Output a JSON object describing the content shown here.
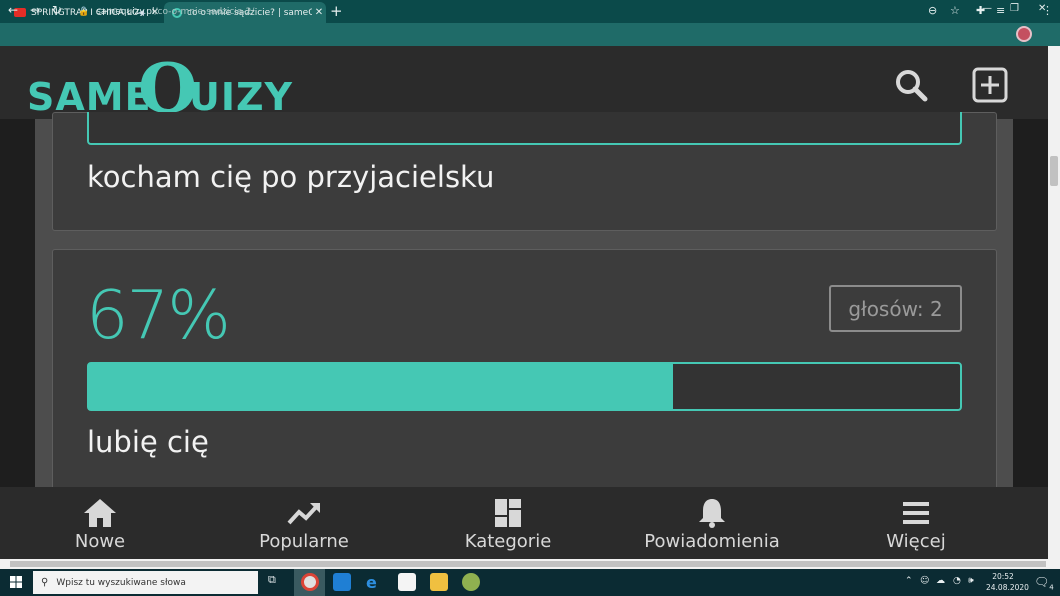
{
  "browser": {
    "tabs": [
      {
        "title": "SPRINGTRAP I CHICA ŁOJĄ M",
        "icon": "youtube-icon"
      },
      {
        "title": "co o mnie sądzicie? | sameQuizy",
        "icon": "samequizy-icon",
        "active": true
      }
    ],
    "url_host": "samequizy.pl",
    "url_path": "/co-o-mnie-sadzicie-2/"
  },
  "site": {
    "logo_same": "SAME",
    "logo_q": "Q",
    "logo_uizy": "UIZY",
    "accent_color": "#45c8b4"
  },
  "results": [
    {
      "answer": "kocham cię po przyjacielsku"
    },
    {
      "percent_label": "67%",
      "percent": 67,
      "votes_label": "głosów: 2",
      "answer": "lubię cię"
    }
  ],
  "bottom_nav": [
    {
      "label": "Nowe",
      "icon": "home-icon"
    },
    {
      "label": "Popularne",
      "icon": "trending-icon"
    },
    {
      "label": "Kategorie",
      "icon": "categories-icon"
    },
    {
      "label": "Powiadomienia",
      "icon": "bell-icon"
    },
    {
      "label": "Więcej",
      "icon": "menu-icon"
    }
  ],
  "taskbar": {
    "search_placeholder": "Wpisz tu wyszukiwane słowa",
    "time": "20:52",
    "date": "24.08.2020",
    "notifications": "4"
  }
}
